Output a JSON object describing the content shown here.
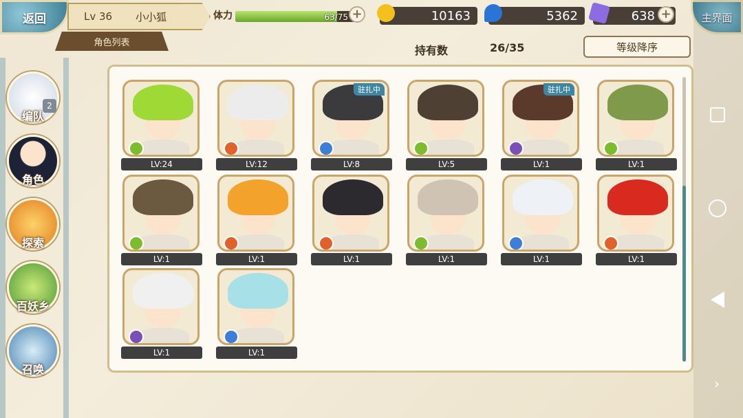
{
  "header": {
    "back_label": "返回",
    "level": "Lv 36",
    "player_name": "小小狐",
    "tab_label": "角色列表",
    "home_label": "主界面"
  },
  "stamina": {
    "label": "体力",
    "value_text": "63/75",
    "current": 63,
    "max": 75
  },
  "currencies": [
    {
      "name": "gold-coin",
      "value": "10163",
      "color": "#f4c01d"
    },
    {
      "name": "blue-flame",
      "value": "5362",
      "color": "#2a74d6"
    },
    {
      "name": "purple-crystal",
      "value": "638",
      "color": "#8d6be0"
    }
  ],
  "toolbar": {
    "owned_label": "持有数",
    "owned_count": "26/35",
    "sort_label": "等级降序"
  },
  "sidebar": {
    "items": [
      {
        "label": "编队",
        "badge": "2"
      },
      {
        "label": "角色"
      },
      {
        "label": "探索"
      },
      {
        "label": "百妖乡"
      },
      {
        "label": "召唤"
      }
    ]
  },
  "characters": [
    {
      "level": "LV:24",
      "element": "wind",
      "hair": "#9ed935"
    },
    {
      "level": "LV:12",
      "element": "fire",
      "hair": "#ececec"
    },
    {
      "level": "LV:8",
      "element": "water",
      "hair": "#3b3a3c",
      "status": "驻扎中"
    },
    {
      "level": "LV:5",
      "element": "wind",
      "hair": "#4e4033"
    },
    {
      "level": "LV:1",
      "element": "dark",
      "hair": "#5b3a2c",
      "status": "驻扎中"
    },
    {
      "level": "LV:1",
      "element": "wind",
      "hair": "#7f9a4a"
    },
    {
      "level": "LV:1",
      "element": "wind",
      "hair": "#6b5a40"
    },
    {
      "level": "LV:1",
      "element": "fire",
      "hair": "#f3a22c"
    },
    {
      "level": "LV:1",
      "element": "fire",
      "hair": "#2c2a2e"
    },
    {
      "level": "LV:1",
      "element": "wind",
      "hair": "#cfc3b4"
    },
    {
      "level": "LV:1",
      "element": "water",
      "hair": "#eef1f5"
    },
    {
      "level": "LV:1",
      "element": "fire",
      "hair": "#d92a1f"
    },
    {
      "level": "LV:1",
      "element": "dark",
      "hair": "#f0f0f0"
    },
    {
      "level": "LV:1",
      "element": "water",
      "hair": "#a8e0e8"
    }
  ],
  "element_colors": {
    "wind": "#7dbb2f",
    "fire": "#e0622a",
    "water": "#3d7fd8",
    "dark": "#7a4fb8"
  }
}
